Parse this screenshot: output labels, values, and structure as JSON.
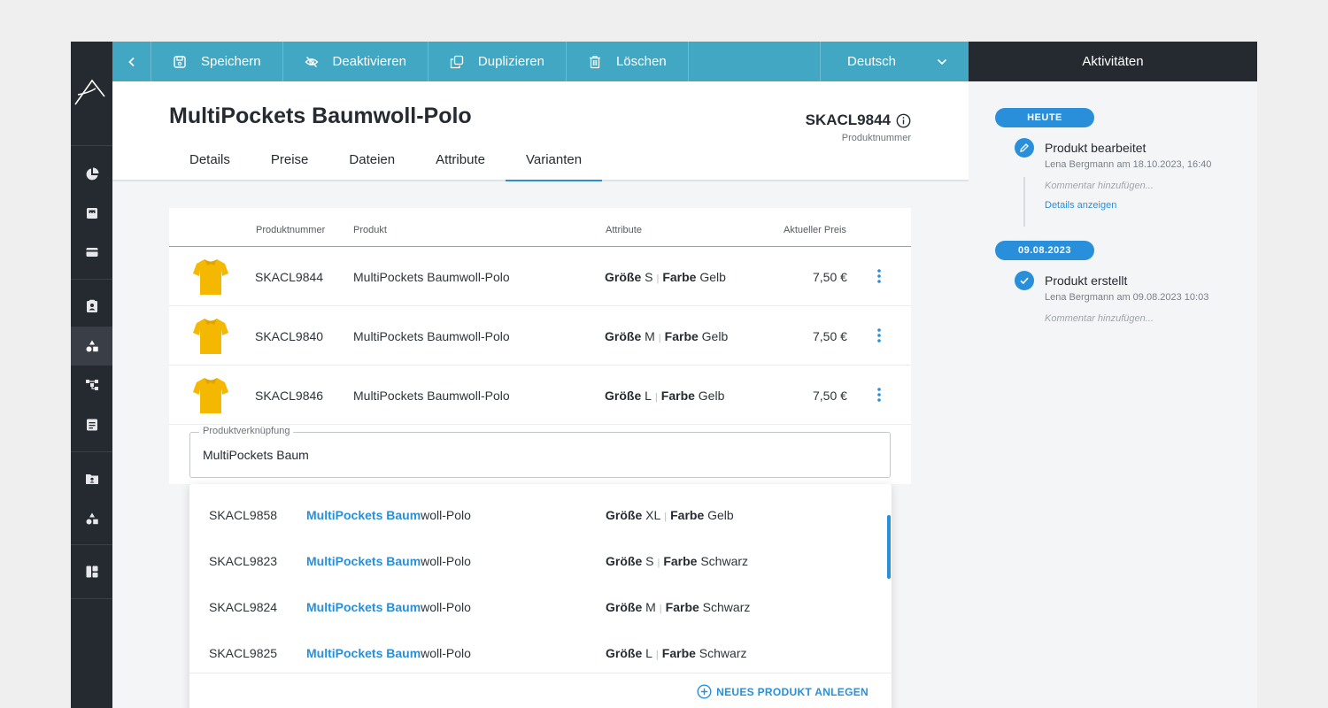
{
  "toolbar": {
    "save": "Speichern",
    "deactivate": "Deaktivieren",
    "duplicate": "Duplizieren",
    "delete": "Löschen",
    "language": "Deutsch"
  },
  "product": {
    "title": "MultiPockets Baumwoll-Polo",
    "sku": "SKACL9844",
    "sku_label": "Produktnummer"
  },
  "tabs": [
    "Details",
    "Preise",
    "Dateien",
    "Attribute",
    "Varianten"
  ],
  "active_tab": "Varianten",
  "table": {
    "headers": {
      "sku": "Produktnummer",
      "product": "Produkt",
      "attributes": "Attribute",
      "price": "Aktueller Preis"
    },
    "rows": [
      {
        "sku": "SKACL9844",
        "product": "MultiPockets Baumwoll-Polo",
        "size_key": "Größe",
        "size": "S",
        "color_key": "Farbe",
        "color": "Gelb",
        "price": "7,50 €"
      },
      {
        "sku": "SKACL9840",
        "product": "MultiPockets Baumwoll-Polo",
        "size_key": "Größe",
        "size": "M",
        "color_key": "Farbe",
        "color": "Gelb",
        "price": "7,50 €"
      },
      {
        "sku": "SKACL9846",
        "product": "MultiPockets Baumwoll-Polo",
        "size_key": "Größe",
        "size": "L",
        "color_key": "Farbe",
        "color": "Gelb",
        "price": "7,50 €"
      }
    ]
  },
  "link_field": {
    "label": "Produktverknüpfung",
    "value": "MultiPockets Baum"
  },
  "suggestions": [
    {
      "sku": "SKACL9858",
      "match": "MultiPockets Baum",
      "rest": "woll-Polo",
      "size_key": "Größe",
      "size": "XL",
      "color_key": "Farbe",
      "color": "Gelb"
    },
    {
      "sku": "SKACL9823",
      "match": "MultiPockets Baum",
      "rest": "woll-Polo",
      "size_key": "Größe",
      "size": "S",
      "color_key": "Farbe",
      "color": "Schwarz"
    },
    {
      "sku": "SKACL9824",
      "match": "MultiPockets Baum",
      "rest": "woll-Polo",
      "size_key": "Größe",
      "size": "M",
      "color_key": "Farbe",
      "color": "Schwarz"
    },
    {
      "sku": "SKACL9825",
      "match": "MultiPockets Baum",
      "rest": "woll-Polo",
      "size_key": "Größe",
      "size": "L",
      "color_key": "Farbe",
      "color": "Schwarz"
    }
  ],
  "new_product_button": "NEUES PRODUKT ANLEGEN",
  "activities": {
    "title": "Aktivitäten",
    "groups": [
      {
        "date": "HEUTE",
        "events": [
          {
            "icon": "pencil-icon",
            "title": "Produkt bearbeitet",
            "meta": "Lena Bergmann am 18.10.2023, 16:40",
            "comment": "Kommentar hinzufügen...",
            "link": "Details anzeigen"
          }
        ]
      },
      {
        "date": "09.08.2023",
        "events": [
          {
            "icon": "check-icon",
            "title": "Produkt erstellt",
            "meta": "Lena Bergmann am 09.08.2023 10:03",
            "comment": "Kommentar hinzufügen..."
          }
        ]
      }
    ]
  },
  "colors": {
    "accent": "#2a8fda",
    "toolbar": "#41a7c2",
    "sidebar": "#252a31",
    "product_yellow": "#f5b800"
  }
}
